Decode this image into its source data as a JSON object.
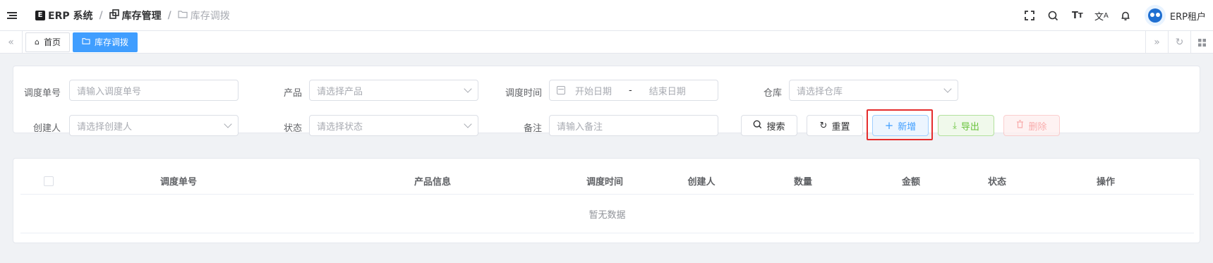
{
  "header": {
    "breadcrumb": [
      {
        "label": "ERP 系统",
        "icon": "erp-logo-icon"
      },
      {
        "label": "库存管理",
        "icon": "inventory-icon"
      },
      {
        "label": "库存调拨",
        "icon": "folder-icon"
      }
    ],
    "user": "ERP租户",
    "right_icons": [
      "fullscreen-icon",
      "search-icon",
      "font-size-icon",
      "translate-icon",
      "bell-icon"
    ]
  },
  "tags": [
    {
      "label": "首页",
      "icon": "home-icon",
      "active": false
    },
    {
      "label": "库存调拨",
      "icon": "folder-icon",
      "active": true
    }
  ],
  "filters": {
    "transfer_no": {
      "label": "调度单号",
      "placeholder": "请输入调度单号"
    },
    "product": {
      "label": "产品",
      "placeholder": "请选择产品"
    },
    "transfer_time": {
      "label": "调度时间",
      "start_placeholder": "开始日期",
      "separator": "-",
      "end_placeholder": "结束日期"
    },
    "warehouse": {
      "label": "仓库",
      "placeholder": "请选择仓库"
    },
    "creator": {
      "label": "创建人",
      "placeholder": "请选择创建人"
    },
    "status": {
      "label": "状态",
      "placeholder": "请选择状态"
    },
    "remark": {
      "label": "备注",
      "placeholder": "请输入备注"
    }
  },
  "actions": {
    "search": "搜索",
    "reset": "重置",
    "add": "新增",
    "export": "导出",
    "delete": "删除"
  },
  "table": {
    "columns": [
      "调度单号",
      "产品信息",
      "调度时间",
      "创建人",
      "数量",
      "金额",
      "状态",
      "操作"
    ],
    "empty_text": "暂无数据"
  },
  "colors": {
    "primary": "#409eff",
    "success": "#67c23a",
    "danger": "#f56c6c",
    "highlight": "#e52d2d"
  }
}
